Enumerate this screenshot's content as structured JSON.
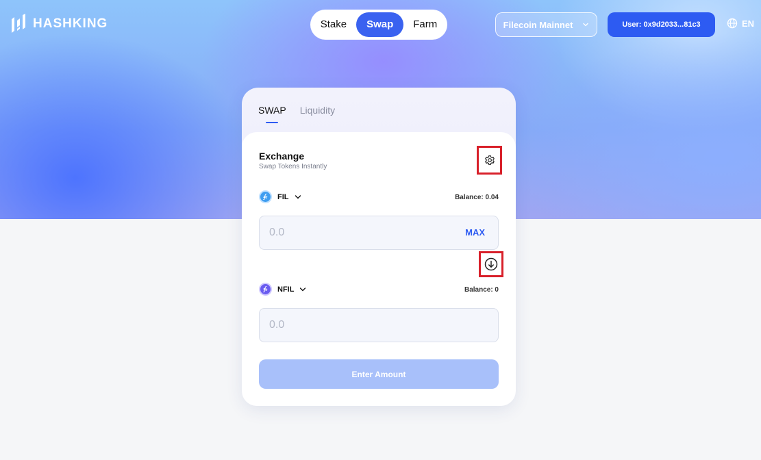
{
  "brand": {
    "name": "HASHKING"
  },
  "nav": {
    "items": [
      {
        "label": "Stake",
        "active": false
      },
      {
        "label": "Swap",
        "active": true
      },
      {
        "label": "Farm",
        "active": false
      }
    ]
  },
  "network": {
    "label": "Filecoin Mainnet"
  },
  "user": {
    "label": "User: 0x9d2033...81c3"
  },
  "language": {
    "label": "EN"
  },
  "card": {
    "tabs": [
      {
        "label": "SWAP",
        "active": true
      },
      {
        "label": "Liquidity",
        "active": false
      }
    ],
    "title": "Exchange",
    "subtitle": "Swap Tokens Instantly",
    "from": {
      "token": "FIL",
      "balance": "Balance: 0.04",
      "placeholder": "0.0",
      "max_label": "MAX",
      "icon": "filecoin-icon"
    },
    "to": {
      "token": "NFIL",
      "balance": "Balance: 0",
      "placeholder": "0.0",
      "icon": "nfil-icon"
    },
    "submit_label": "Enter Amount"
  },
  "colors": {
    "accent": "#2d5bf2",
    "highlight_box": "#d8202a",
    "disabled_button": "#a8c0fa"
  }
}
